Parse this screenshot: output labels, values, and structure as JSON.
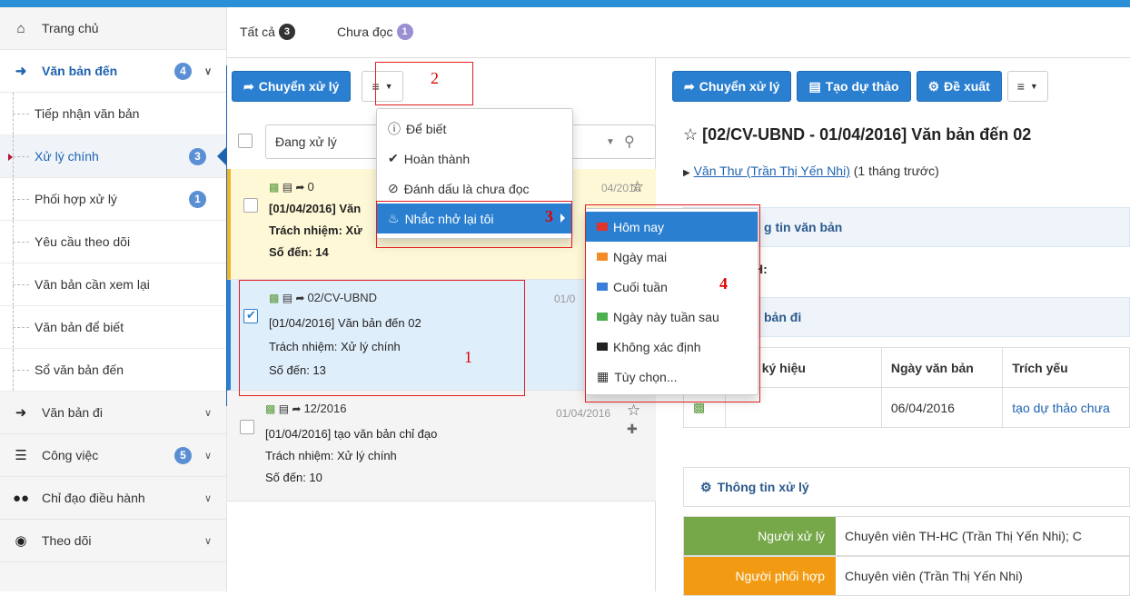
{
  "colors": {
    "accent": "#2a7fd0",
    "topbar": "#2a8fd6",
    "badge": "#5b8fd4",
    "tab_all_badge": "#333333",
    "tab_unread_badge": "#9b8fd4",
    "highlight_card": "#fff8d6",
    "highlight_card_border": "#f0b429",
    "selected_card": "#dfeefb",
    "annotation": "#e01e1e",
    "processor_label": "#76a84a",
    "coordinator_label": "#f29b12",
    "flag_today": "#e0342c",
    "flag_tomorrow": "#f28c28",
    "flag_weekend": "#3b7dd8",
    "flag_next_week": "#4caf50",
    "flag_undefined": "#222222"
  },
  "sidebar": {
    "home": {
      "label": "Trang chủ",
      "icon": "home-icon"
    },
    "incoming": {
      "label": "Văn bản đến",
      "count": "4",
      "icon": "arrow-circle-icon"
    },
    "sub_items": [
      {
        "label": "Tiếp nhận văn bản"
      },
      {
        "label": "Xử lý chính",
        "count": "3"
      },
      {
        "label": "Phối hợp xử lý",
        "count": "1"
      },
      {
        "label": "Yêu cầu theo dõi"
      },
      {
        "label": "Văn bản cần xem lại"
      },
      {
        "label": "Văn bản để biết"
      },
      {
        "label": "Sổ văn bản đến"
      }
    ],
    "outgoing": {
      "label": "Văn bản đi",
      "icon": "arrow-circle-icon"
    },
    "tasks": {
      "label": "Công việc",
      "count": "5",
      "icon": "list-icon"
    },
    "direction": {
      "label": "Chỉ đạo điều hành",
      "icon": "users-icon"
    },
    "follow": {
      "label": "Theo dõi",
      "icon": "eye-icon"
    }
  },
  "tabs": [
    {
      "label": "Tất cả",
      "count": "3"
    },
    {
      "label": "Chưa đọc",
      "count": "1"
    }
  ],
  "list_toolbar": {
    "forward_label": "Chuyển xử lý",
    "menu_icon": "hamburger-icon"
  },
  "filter": {
    "status": "Đang xử lý"
  },
  "cards": [
    {
      "icon_count": "0",
      "title": "[01/04/2016] Văn",
      "resp": "Trách nhiệm: Xử",
      "num": "Số đến: 14",
      "date": "04/2016"
    },
    {
      "icon_count": "02/CV-UBND",
      "title": "[01/04/2016] Văn bản đến 02",
      "resp": "Trách nhiệm: Xử lý chính",
      "num": "Số đến: 13",
      "date": "01/0"
    },
    {
      "icon_count": "12/2016",
      "title": "[01/04/2016] tạo văn bản chỉ đạo",
      "resp": "Trách nhiệm: Xử lý chính",
      "num": "Số đến: 10",
      "date": "01/04/2016"
    }
  ],
  "action_menu": [
    {
      "label": "Để biết",
      "icon": "info-icon"
    },
    {
      "label": "Hoàn thành",
      "icon": "check-icon"
    },
    {
      "label": "Đánh dấu là chưa đọc",
      "icon": "eye-slash-icon"
    },
    {
      "label": "Nhắc nhở lại tôi",
      "icon": "bell-icon"
    }
  ],
  "remind_menu": [
    {
      "label": "Hôm nay",
      "icon": "flag-icon"
    },
    {
      "label": "Ngày mai",
      "icon": "flag-icon"
    },
    {
      "label": "Cuối tuần",
      "icon": "flag-icon"
    },
    {
      "label": "Ngày này tuần sau",
      "icon": "flag-icon"
    },
    {
      "label": "Không xác định",
      "icon": "flag-icon"
    },
    {
      "label": "Tùy chọn...",
      "icon": "calendar-icon"
    }
  ],
  "annotations": [
    "1",
    "2",
    "3",
    "4"
  ],
  "detail_toolbar": {
    "forward_label": "Chuyển xử lý",
    "draft_label": "Tạo dự thảo",
    "propose_label": "Đề xuất"
  },
  "detail": {
    "title": "[02/CV-UBND - 01/04/2016] Văn bản đến 02",
    "sender_link": "Văn Thư (Trần Thị Yến Nhi)",
    "sender_time": "(1 tháng trước)",
    "info_head": "g tin văn bản",
    "field_partial": "H:",
    "outgoing_head": "bản đi",
    "table_headers": [
      "ký hiệu",
      "Ngày văn bản",
      "Trích yếu"
    ],
    "table_row": {
      "date": "06/04/2016",
      "summary": "tạo dự thảo chưa"
    },
    "process_head": "Thông tin xử lý",
    "processor_label": "Người xử lý",
    "processor_value": "Chuyên viên TH-HC (Trần Thị Yến Nhi); C",
    "coordinator_label": "Người phối hợp",
    "coordinator_value": "Chuyên viên (Trần Thị Yến Nhi)"
  }
}
